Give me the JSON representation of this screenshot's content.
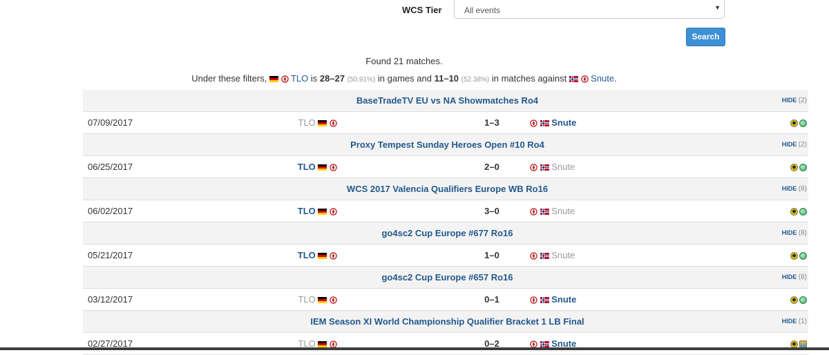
{
  "filter": {
    "label": "WCS Tier",
    "value": "All events",
    "caret": "▼"
  },
  "search_button": "Search",
  "found_text": "Found 21 matches.",
  "summary": {
    "prefix": "Under these filters,",
    "player": "TLO",
    "is": "is",
    "games_record": "28–27",
    "games_pct": "(50.91%)",
    "in_games_and": "in games and",
    "matches_record": "11–10",
    "matches_pct": "(52.38%)",
    "in_matches_against": "in matches against",
    "opponent": "Snute",
    "end": "."
  },
  "hide_label": "HIDE",
  "groups": [
    {
      "event": "BaseTradeTV EU vs NA Showmatches Ro4",
      "hide_count": "(2)",
      "match": {
        "date": "07/09/2017",
        "p1": "TLO",
        "score": "1–3",
        "p2": "Snute",
        "winner": "p2",
        "icons": [
          "bw",
          "globe"
        ]
      }
    },
    {
      "event": "Proxy Tempest Sunday Heroes Open #10 Ro4",
      "hide_count": "(2)",
      "match": {
        "date": "06/25/2017",
        "p1": "TLO",
        "score": "2–0",
        "p2": "Snute",
        "winner": "p1",
        "icons": [
          "bw",
          "globe"
        ]
      }
    },
    {
      "event": "WCS 2017 Valencia Qualifiers Europe WB Ro16",
      "hide_count": "(8)",
      "match": {
        "date": "06/02/2017",
        "p1": "TLO",
        "score": "3–0",
        "p2": "Snute",
        "winner": "p1",
        "icons": [
          "bw",
          "globe"
        ]
      }
    },
    {
      "event": "go4sc2 Cup Europe #677 Ro16",
      "hide_count": "(8)",
      "match": {
        "date": "05/21/2017",
        "p1": "TLO",
        "score": "1–0",
        "p2": "Snute",
        "winner": "p1",
        "icons": [
          "bw",
          "globe"
        ]
      }
    },
    {
      "event": "go4sc2 Cup Europe #657 Ro16",
      "hide_count": "(8)",
      "match": {
        "date": "03/12/2017",
        "p1": "TLO",
        "score": "0–1",
        "p2": "Snute",
        "winner": "p2",
        "icons": [
          "bw",
          "globe"
        ]
      }
    },
    {
      "event": "IEM Season XI World Championship Qualifier Bracket 1 LB Final",
      "hide_count": "(1)",
      "match": {
        "date": "02/27/2017",
        "p1": "TLO",
        "score": "0–2",
        "p2": "Snute",
        "winner": "p2",
        "icons": [
          "bw",
          "people"
        ]
      }
    }
  ],
  "colors": {
    "link_blue": "#23598e",
    "button_blue": "#3d8fd6",
    "loser_gray": "#9a9a9a",
    "row_shade": "#f3f3f3"
  }
}
